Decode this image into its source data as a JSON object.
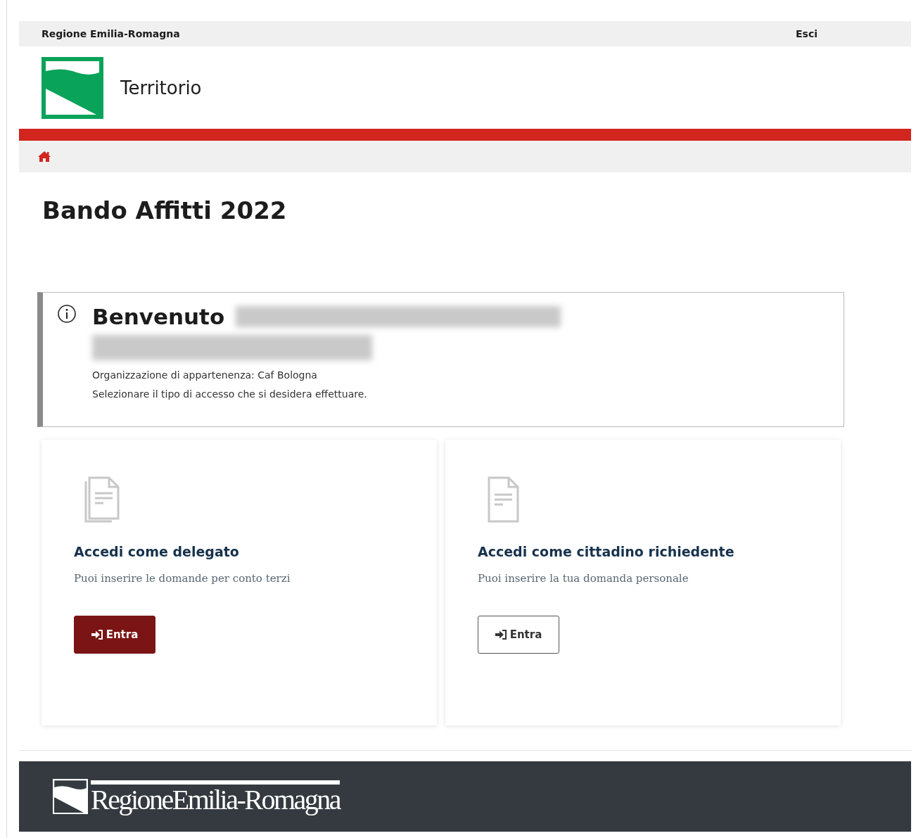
{
  "top_bar": {
    "region": "Regione Emilia-Romagna",
    "logout": "Esci"
  },
  "header": {
    "title": "Territorio"
  },
  "page_title": "Bando Affitti 2022",
  "welcome": {
    "greeting": "Benvenuto",
    "organization": "Organizzazione di appartenenza: Caf Bologna",
    "instruction": "Selezionare il tipo di accesso che si desidera effettuare."
  },
  "cards": [
    {
      "kind": "documents",
      "title": "Accedi come delegato",
      "description": "Puoi inserire le domande per conto terzi",
      "button": {
        "label": "Entra",
        "kind": "primary"
      }
    },
    {
      "kind": "document",
      "title": "Accedi come cittadino richiedente",
      "description": "Puoi inserire la tua domanda personale",
      "button": {
        "label": "Entra",
        "kind": "outline"
      }
    }
  ],
  "footer": {
    "logo_text": "RegioneEmilia-Romagna"
  }
}
